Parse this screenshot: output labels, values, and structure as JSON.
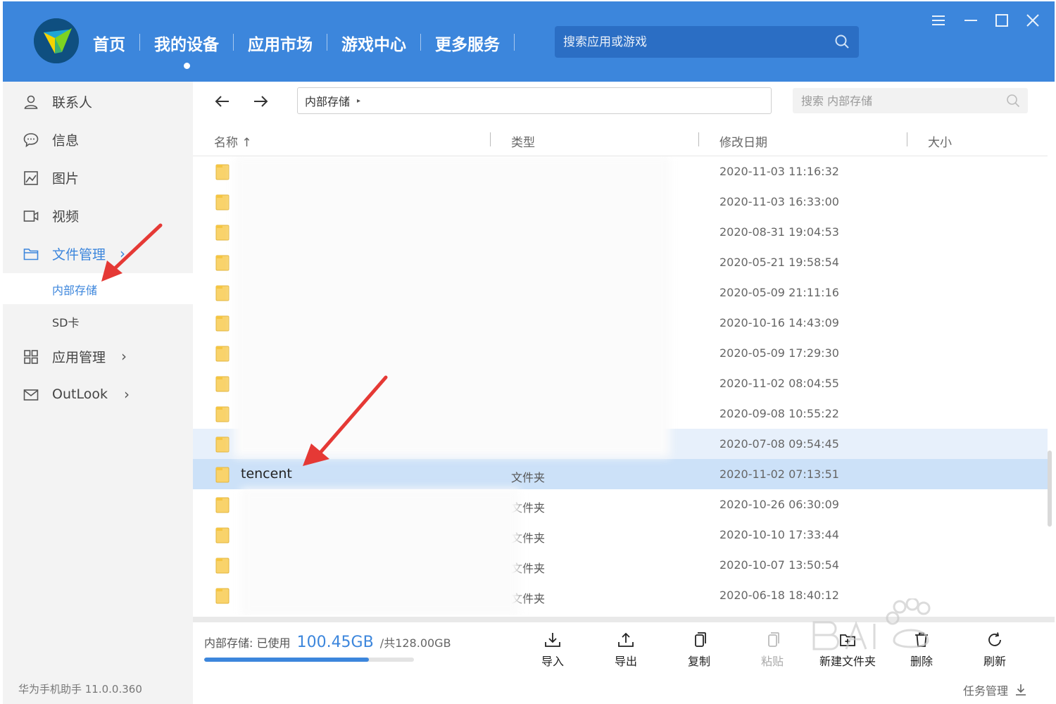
{
  "header": {
    "nav": [
      {
        "label": "首页",
        "active": false
      },
      {
        "label": "我的设备",
        "active": true
      },
      {
        "label": "应用市场",
        "active": false
      },
      {
        "label": "游戏中心",
        "active": false
      },
      {
        "label": "更多服务",
        "active": false
      }
    ],
    "search_placeholder": "搜索应用或游戏",
    "colors": {
      "brand": "#3c86dc",
      "search_bg": "#2b6ec4"
    }
  },
  "sidebar": {
    "items": [
      {
        "label": "联系人",
        "icon": "person-icon"
      },
      {
        "label": "信息",
        "icon": "message-icon"
      },
      {
        "label": "图片",
        "icon": "image-icon"
      },
      {
        "label": "视频",
        "icon": "video-icon"
      },
      {
        "label": "文件管理",
        "icon": "folder-icon",
        "chevron": "›",
        "active": true
      },
      {
        "label": "应用管理",
        "icon": "apps-grid-icon",
        "chevron": "›"
      },
      {
        "label": "OutLook",
        "icon": "mail-icon",
        "chevron": "›"
      }
    ],
    "sub_items": [
      {
        "label": "内部存储",
        "active": true
      },
      {
        "label": "SD卡",
        "active": false
      }
    ],
    "version": "华为手机助手 11.0.0.360"
  },
  "toolbar": {
    "breadcrumb": "内部存储",
    "breadcrumb_caret": "▸",
    "search_placeholder": "搜索 内部存储"
  },
  "columns": {
    "name": "名称 ↑",
    "type": "类型",
    "date": "修改日期",
    "size": "大小"
  },
  "rows": [
    {
      "name": "",
      "type": "",
      "date": "2020-11-03 11:16:32"
    },
    {
      "name": "",
      "type": "",
      "date": "2020-11-03 16:33:00"
    },
    {
      "name": "",
      "type": "",
      "date": "2020-08-31 19:04:53"
    },
    {
      "name": "",
      "type": "",
      "date": "2020-05-21 19:58:54"
    },
    {
      "name": "",
      "type": "",
      "date": "2020-05-09 21:11:16"
    },
    {
      "name": "",
      "type": "",
      "date": "2020-10-16 14:43:09"
    },
    {
      "name": "",
      "type": "",
      "date": "2020-05-09 17:29:30"
    },
    {
      "name": "",
      "type": "",
      "date": "2020-11-02 08:04:55"
    },
    {
      "name": "",
      "type": "",
      "date": "2020-09-08 10:55:22"
    },
    {
      "name": "",
      "type": "",
      "date": "2020-07-08 09:54:45",
      "state": "hover"
    },
    {
      "name": "tencent",
      "type": "文件夹",
      "date": "2020-11-02 07:13:51",
      "state": "selected"
    },
    {
      "name": "",
      "type": "文件夹",
      "date": "2020-10-26 06:30:09"
    },
    {
      "name": "",
      "type": "文件夹",
      "date": "2020-10-10 17:33:44"
    },
    {
      "name": "",
      "type": "文件夹",
      "date": "2020-10-07 13:50:54"
    },
    {
      "name": "",
      "type": "文件夹",
      "date": "2020-06-18 18:40:12"
    }
  ],
  "storage": {
    "label": "内部存储: 已使用",
    "used": "100.45GB",
    "total": "/共128.00GB",
    "used_fraction": 0.785
  },
  "actions": [
    {
      "label": "导入",
      "icon": "import-icon",
      "enabled": true
    },
    {
      "label": "导出",
      "icon": "export-icon",
      "enabled": true
    },
    {
      "label": "复制",
      "icon": "copy-icon",
      "enabled": true
    },
    {
      "label": "粘贴",
      "icon": "paste-icon",
      "enabled": false
    },
    {
      "label": "新建文件夹",
      "icon": "new-folder-icon",
      "enabled": true
    },
    {
      "label": "删除",
      "icon": "delete-icon",
      "enabled": true
    },
    {
      "label": "刷新",
      "icon": "refresh-icon",
      "enabled": true
    }
  ],
  "task_manager": "任务管理",
  "annotation_color": "#e53935"
}
